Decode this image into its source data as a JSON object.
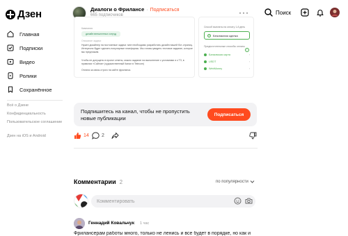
{
  "app": {
    "logo_text": "Дзен"
  },
  "channel": {
    "name": "Диалоги о Фрилансе",
    "dot": "·",
    "subscribe_link": "Подписаться",
    "subscribers": "665 подписчиков"
  },
  "header": {
    "more": "···",
    "search_label": "Поиск"
  },
  "sidebar": {
    "items": [
      {
        "label": "Главная",
        "icon": "home-icon"
      },
      {
        "label": "Подписки",
        "icon": "subscriptions-icon"
      },
      {
        "label": "Видео",
        "icon": "video-icon"
      },
      {
        "label": "Ролики",
        "icon": "shorts-icon"
      },
      {
        "label": "Сохранённое",
        "icon": "bookmark-icon"
      }
    ],
    "links": [
      "Всё о Дзене",
      "Конфиденциальность",
      "Пользовательское соглашение",
      "Дзен на iOS и Android"
    ]
  },
  "fragment": {
    "tag": "Кампания",
    "chip": "дизайн внештатных сотруд",
    "label1": "Описание задачи",
    "text1": "Нужен дизайнер на постоянные задачи: мне необходимо разработать дизайн нашей бот-страниц. Интересно будет сделать популярные платформы. Мы готовы увидеть тестовое задание, которое мы предложим.",
    "text2": "Чтобы не допущено в проект ответы, можно задание на выполнение с условиями и к ТЗ, в правилах «Сайтов» (художественный Канал в Telecom)",
    "text3": "Оплата за связь строго на сайте фриланса.",
    "right_head": "Способ выплаты на оплату 1-й день",
    "safe_deal": "Безопасная сделка",
    "info": "i",
    "pay_head": "Предпочтительные способы оплаты",
    "payments": [
      "Банковская карта",
      "USDT",
      "WebMoney"
    ],
    "chev": "›"
  },
  "subscribe_card": {
    "text": "Подпишитесь на канал, чтобы не пропустить новые публикации",
    "button": "Подписаться"
  },
  "reactions": {
    "likes": "14",
    "comments": "2"
  },
  "comments": {
    "title": "Комментарии",
    "count": "2",
    "sort": "по популярности",
    "input_placeholder": "Комментировать",
    "first": {
      "author": "Геннадий Ковальчук",
      "time": "1 час",
      "text": "Фрилансерам работы много, только не ленись и все будет в порядке, но как и"
    }
  },
  "colors": {
    "accent": "#ff4b1f",
    "green": "#4caf50"
  }
}
